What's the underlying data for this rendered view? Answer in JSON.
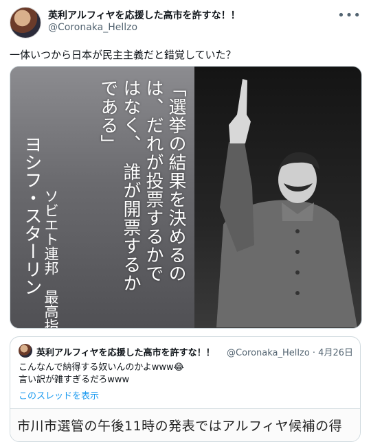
{
  "author": {
    "display_name": "英利アルフィヤを応援した高市を許すな！！",
    "handle": "@Coronaka_Hellzo"
  },
  "tweet": {
    "text": "一体いつから日本が民主主義だと錯覚していた？"
  },
  "image_text": {
    "quote_columns": [
      "「選挙の結果を決めるの",
      "は、だれが投票するかで",
      "はなく、　誰が開票するか",
      "である」"
    ],
    "attribution_columns": [
      "ソビエト連邦　最高指導者",
      "ヨシフ・スターリン"
    ]
  },
  "quoted_tweet": {
    "display_name": "英利アルフィヤを応援した高市を許すな！！",
    "meta": "@Coronaka_Hellzo · 4月26日",
    "line1": "こんなんで納得する奴いんのかよwww😂",
    "line2": "言い訳が雑すぎるだろwww",
    "show_thread": "このスレッドを表示",
    "media_text": "市川市選管の午後11時の発表ではアルフィヤ候補の得"
  },
  "icons": {
    "more": "more-horizontal-icon"
  }
}
